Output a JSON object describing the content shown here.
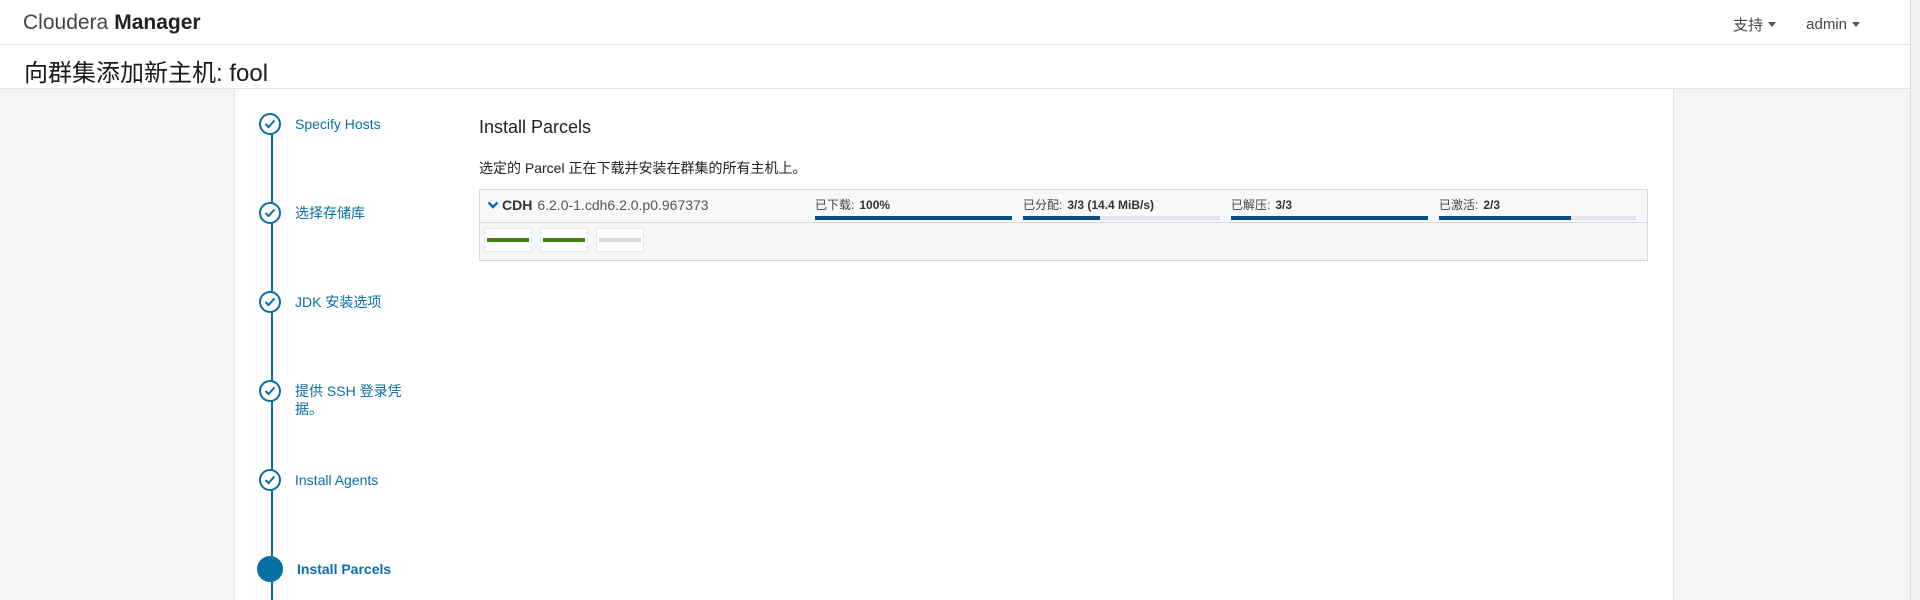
{
  "navbar": {
    "brand_light": "Cloudera",
    "brand_bold": "Manager",
    "support_label": "支持",
    "user_label": "admin"
  },
  "page": {
    "title": "向群集添加新主机: fool"
  },
  "wizard": {
    "steps": [
      {
        "label": "Specify Hosts",
        "state": "complete"
      },
      {
        "label": "选择存储库",
        "state": "complete"
      },
      {
        "label": "JDK 安装选项",
        "state": "complete"
      },
      {
        "label": "提供 SSH 登录凭据。",
        "state": "complete"
      },
      {
        "label": "Install Agents",
        "state": "complete"
      },
      {
        "label": "Install Parcels",
        "state": "active"
      }
    ]
  },
  "main": {
    "title": "Install Parcels",
    "description": "选定的 Parcel 正在下载并安装在群集的所有主机上。",
    "parcel": {
      "product": "CDH",
      "version": "6.2.0-1.cdh6.2.0.p0.967373",
      "stats": [
        {
          "label": "已下载:",
          "value": "100%",
          "fraction": 1.0
        },
        {
          "label": "已分配:",
          "value": "3/3 (14.4 MiB/s)",
          "fraction": 0.39
        },
        {
          "label": "已解压:",
          "value": "3/3",
          "fraction": 1.0
        },
        {
          "label": "已激活:",
          "value": "2/3",
          "fraction": 0.67
        }
      ],
      "hosts": [
        {
          "status": "complete"
        },
        {
          "status": "complete"
        },
        {
          "status": "pending"
        }
      ]
    }
  },
  "colors": {
    "accent": "#0a6ea6",
    "progress": "#0a4d80",
    "host_complete": "#3e7f0f",
    "host_pending": "#dcdcdc"
  }
}
